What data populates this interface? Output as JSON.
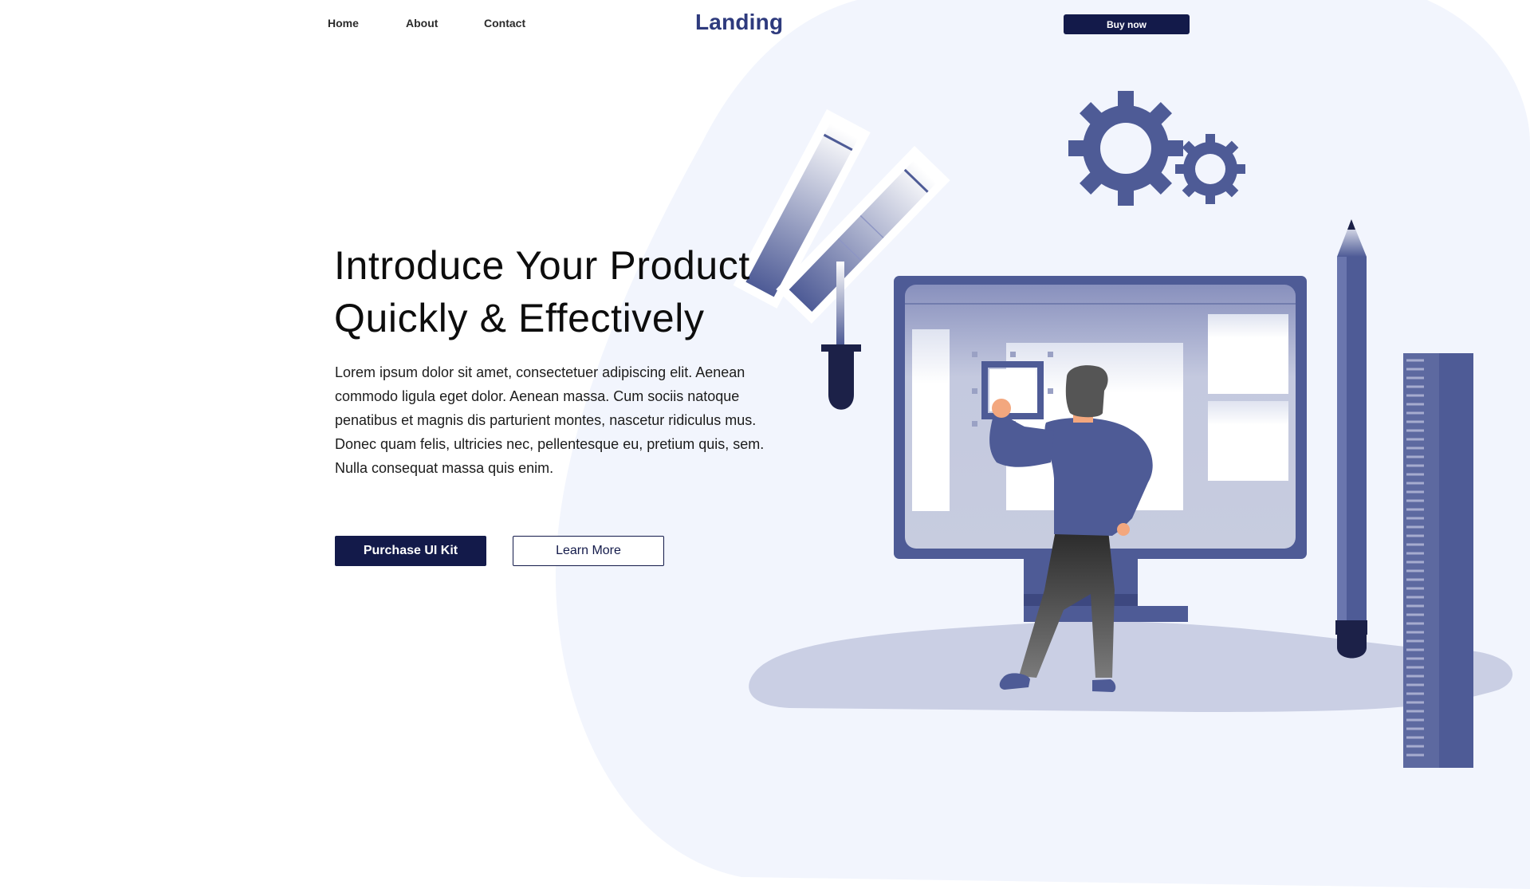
{
  "nav": {
    "links": [
      "Home",
      "About",
      "Contact"
    ],
    "logo": "Landing",
    "buy_label": "Buy now"
  },
  "hero": {
    "title_line1": "Introduce Your Product",
    "title_line2": "Quickly & Effectively",
    "description": "Lorem ipsum dolor sit amet, consectetuer adipiscing elit. Aenean commodo ligula eget dolor. Aenean massa. Cum sociis natoque penatibus et magnis dis parturient montes, nascetur ridiculus mus. Donec quam felis, ultricies nec, pellentesque eu, pretium quis, sem. Nulla consequat massa quis enim.",
    "primary_label": "Purchase UI Kit",
    "secondary_label": "Learn More"
  },
  "colors": {
    "brand": "#2e3a7d",
    "button_dark": "#131a4a",
    "illustration": "#4e5b96",
    "blob": "#f2f5fd"
  },
  "illustration": {
    "icons": [
      "color-swatch-icon",
      "dropper-icon",
      "gear-icon",
      "monitor-icon",
      "person-icon",
      "pencil-icon",
      "ruler-icon"
    ]
  }
}
